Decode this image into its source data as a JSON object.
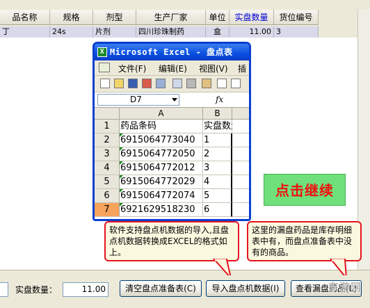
{
  "grid": {
    "columns": [
      "品名称",
      "规格",
      "剂型",
      "生产厂家",
      "单位",
      "实盘数量",
      "货位编号"
    ],
    "row": [
      "丁",
      "24s",
      "片剂",
      "四川珍珠制药",
      "盒",
      "11.00",
      "3"
    ]
  },
  "excel": {
    "title": "Microsoft Excel - 盘点表",
    "menu": [
      "文件(F)",
      "编辑(E)",
      "视图(V)",
      "插"
    ],
    "namebox": "D7",
    "fx": "fx",
    "col_heads": [
      "A",
      "B"
    ],
    "rows": [
      {
        "n": "1",
        "a": "药品条码",
        "b": "实盘数量"
      },
      {
        "n": "2",
        "a": "6915064773040",
        "b": "1"
      },
      {
        "n": "3",
        "a": "6915064772050",
        "b": "2"
      },
      {
        "n": "4",
        "a": "6915064772012",
        "b": "3"
      },
      {
        "n": "5",
        "a": "6915064772029",
        "b": "4"
      },
      {
        "n": "6",
        "a": "6915064772074",
        "b": "5"
      },
      {
        "n": "7",
        "a": "6921629518230",
        "b": "6"
      }
    ]
  },
  "continue_label": "点击继续",
  "callout_left": "软件支持盘点机数据的导入,且盘点机数据转换成EXCEL的格式如上。",
  "callout_right": "这里的漏盘药品是库存明细表中有，而盘点准备表中没有的商品。",
  "bottom": {
    "qty_label": "实盘数量：",
    "qty_value": "11.00",
    "btn_clear": "清空盘点准备表(C)",
    "btn_import": "导入盘点机数据(I)",
    "btn_view": "查看漏盘药品(L)",
    "watermark": "东游网"
  },
  "colors": {
    "accent": "#0a3fd0",
    "callout_border": "#e4141e",
    "go_bg": "#6fe07a",
    "go_text": "#f01010"
  }
}
